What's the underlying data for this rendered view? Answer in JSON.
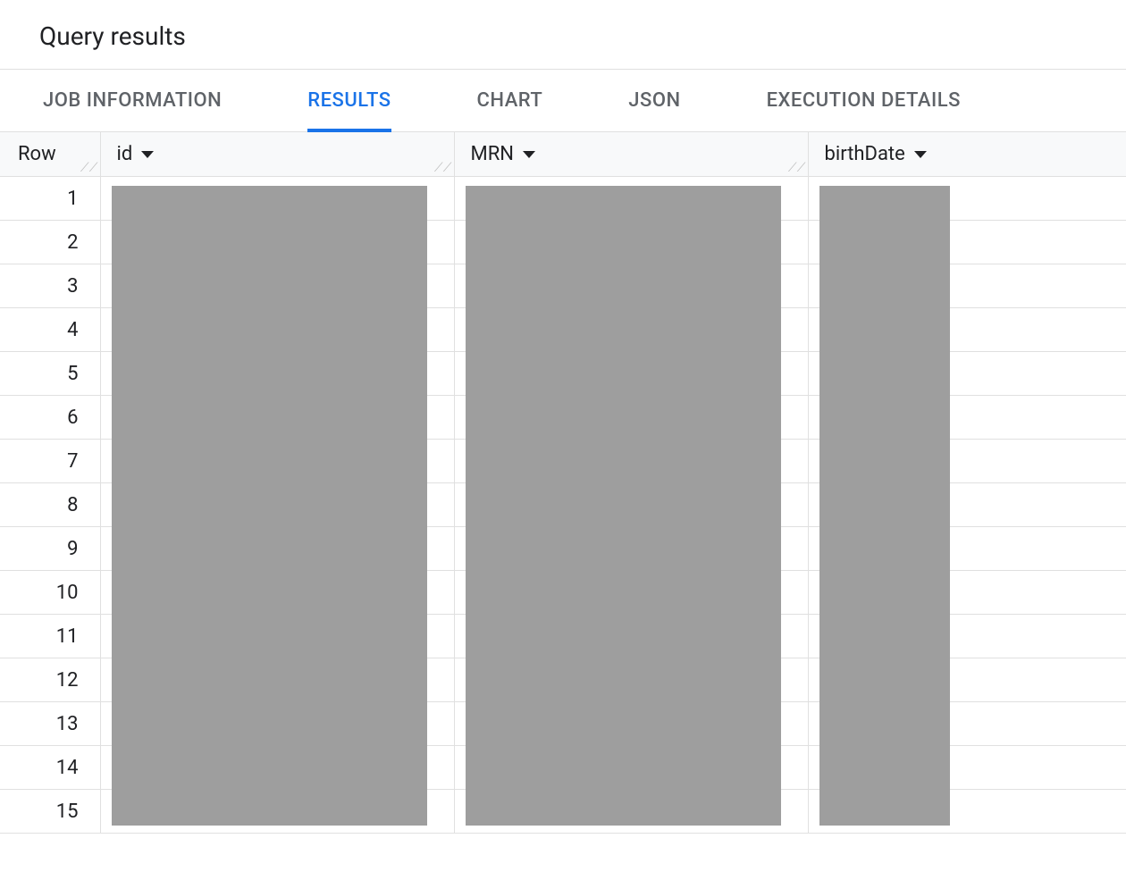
{
  "header": {
    "title": "Query results"
  },
  "tabs": [
    {
      "label": "JOB INFORMATION",
      "active": false
    },
    {
      "label": "RESULTS",
      "active": true
    },
    {
      "label": "CHART",
      "active": false
    },
    {
      "label": "JSON",
      "active": false
    },
    {
      "label": "EXECUTION DETAILS",
      "active": false
    }
  ],
  "table": {
    "rowHeader": "Row",
    "columns": [
      {
        "label": "id",
        "key": "id"
      },
      {
        "label": "MRN",
        "key": "mrn"
      },
      {
        "label": "birthDate",
        "key": "birthDate"
      }
    ],
    "rows": [
      {
        "num": "1"
      },
      {
        "num": "2"
      },
      {
        "num": "3"
      },
      {
        "num": "4"
      },
      {
        "num": "5"
      },
      {
        "num": "6"
      },
      {
        "num": "7"
      },
      {
        "num": "8"
      },
      {
        "num": "9"
      },
      {
        "num": "10"
      },
      {
        "num": "11"
      },
      {
        "num": "12"
      },
      {
        "num": "13"
      },
      {
        "num": "14"
      },
      {
        "num": "15"
      }
    ]
  }
}
